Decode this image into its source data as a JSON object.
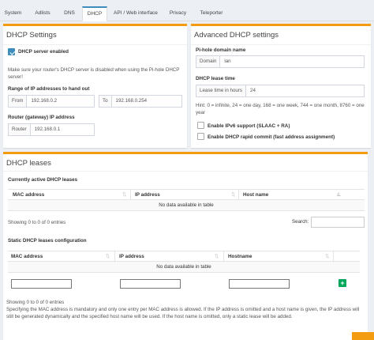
{
  "tabs": [
    {
      "label": "System"
    },
    {
      "label": "Adlists"
    },
    {
      "label": "DNS"
    },
    {
      "label": "DHCP"
    },
    {
      "label": "API / Web interface"
    },
    {
      "label": "Privacy"
    },
    {
      "label": "Teleporter"
    }
  ],
  "dhcp_settings": {
    "title": "DHCP Settings",
    "server_enabled_label": "DHCP server enabled",
    "server_enabled": true,
    "note": "Make sure your router's DHCP server is disabled when using the Pi-hole DHCP server!",
    "range_label": "Range of IP addresses to hand out",
    "from_addon": "From",
    "from_value": "192.168.0.2",
    "to_addon": "To",
    "to_value": "192.168.0.254",
    "router_label": "Router (gateway) IP address",
    "router_addon": "Router",
    "router_value": "192.168.0.1"
  },
  "advanced": {
    "title": "Advanced DHCP settings",
    "domain_label": "Pi-hole domain name",
    "domain_addon": "Domain",
    "domain_value": "lan",
    "lease_label": "DHCP lease time",
    "lease_addon": "Lease time in hours",
    "lease_value": "24",
    "hint": "Hint: 0 = infinite, 24 = one day, 168 = one week, 744 = one month, 8760 = one year",
    "ipv6_label": "Enable IPv6 support (SLAAC + RA)",
    "ipv6_checked": false,
    "rapid_label": "Enable DHCP rapid commit (fast address assignment)",
    "rapid_checked": false
  },
  "leases": {
    "title": "DHCP leases",
    "active_heading": "Currently active DHCP leases",
    "active_columns": [
      "MAC address",
      "IP address",
      "Host name"
    ],
    "active_empty": "No data available in table",
    "active_info": "Showing 0 to 0 of 0 entries",
    "search_label": "Search:",
    "search_value": "",
    "static_heading": "Static DHCP leases configuration",
    "static_columns": [
      "MAC address",
      "IP address",
      "Hostname"
    ],
    "static_empty": "No data available in table",
    "static_info": "Showing 0 to 0 of 0 entries",
    "static_note": "Specifying the MAC address is mandatory and only one entry per MAC address is allowed. If the IP address is omitted and a host name is given, the IP address will still be generated dynamically and the specified host name will be used. If the host name is omitted, only a static lease will be added.",
    "add_symbol": "+"
  },
  "colors": {
    "accent": "#3c8dbc",
    "box_border": "#f39c12",
    "add_button": "#00a65a",
    "background": "#ecf0f5"
  }
}
